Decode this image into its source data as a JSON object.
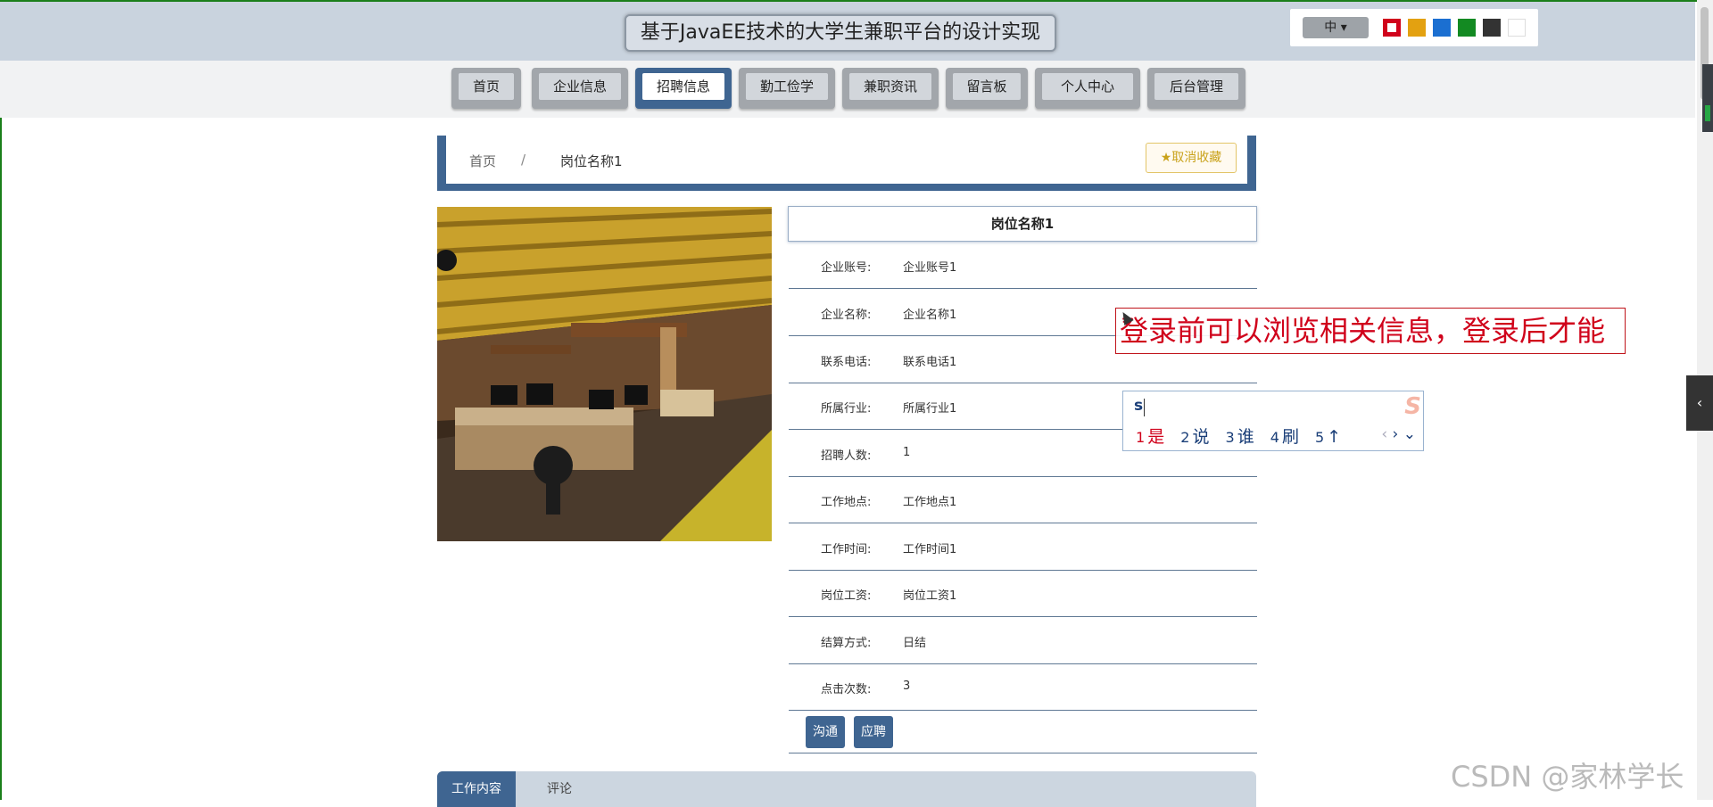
{
  "header": {
    "title": "基于JavaEE技术的大学生兼职平台的设计实现",
    "lang_label": "中",
    "theme_colors": [
      "#d0021b",
      "#e3a111",
      "#1b6fd1",
      "#138a22",
      "#333333",
      "#ffffff"
    ]
  },
  "nav": {
    "items": [
      {
        "label": "首页"
      },
      {
        "label": "企业信息"
      },
      {
        "label": "招聘信息"
      },
      {
        "label": "勤工俭学"
      },
      {
        "label": "兼职资讯"
      },
      {
        "label": "留言板"
      },
      {
        "label": "个人中心"
      },
      {
        "label": "后台管理"
      }
    ],
    "active": "招聘信息"
  },
  "breadcrumb": {
    "home": "首页",
    "separator": "/",
    "current": "岗位名称1",
    "favorite_label": "取消收藏"
  },
  "detail": {
    "title": "岗位名称1",
    "fields": [
      {
        "label": "企业账号:",
        "value": "企业账号1"
      },
      {
        "label": "企业名称:",
        "value": "企业名称1"
      },
      {
        "label": "联系电话:",
        "value": "联系电话1"
      },
      {
        "label": "所属行业:",
        "value": "所属行业1"
      },
      {
        "label": "招聘人数:",
        "value": "1"
      },
      {
        "label": "工作地点:",
        "value": "工作地点1"
      },
      {
        "label": "工作时间:",
        "value": "工作时间1"
      },
      {
        "label": "岗位工资:",
        "value": "岗位工资1"
      },
      {
        "label": "结算方式:",
        "value": "日结"
      },
      {
        "label": "点击次数:",
        "value": "3"
      }
    ],
    "buttons": {
      "communicate": "沟通",
      "apply": "应聘"
    }
  },
  "tabs": {
    "content": "工作内容",
    "comments": "评论"
  },
  "annotation": "登录前可以浏览相关信息，登录后才能",
  "ime": {
    "input": "s",
    "candidates": [
      {
        "num": "1",
        "text": "是"
      },
      {
        "num": "2",
        "text": "说"
      },
      {
        "num": "3",
        "text": "谁"
      },
      {
        "num": "4",
        "text": "刷"
      },
      {
        "num": "5",
        "text": "↑"
      }
    ]
  },
  "watermark": "CSDN @家林学长"
}
